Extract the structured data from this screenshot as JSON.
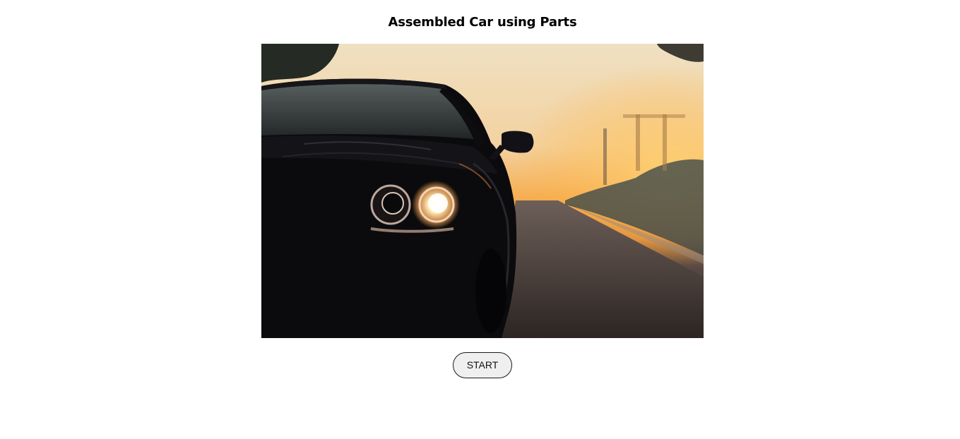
{
  "page": {
    "title": "Assembled Car using Parts"
  },
  "hero_image": {
    "subject": "car-photo"
  },
  "controls": {
    "start_label": "START"
  },
  "colors": {
    "background": "#ffffff",
    "button_bg": "#efefef",
    "button_border": "#1a1a1a",
    "sky_top": "#f2dcb4",
    "sky_horizon": "#f7a43a",
    "car_body": "#0b0b0e"
  }
}
